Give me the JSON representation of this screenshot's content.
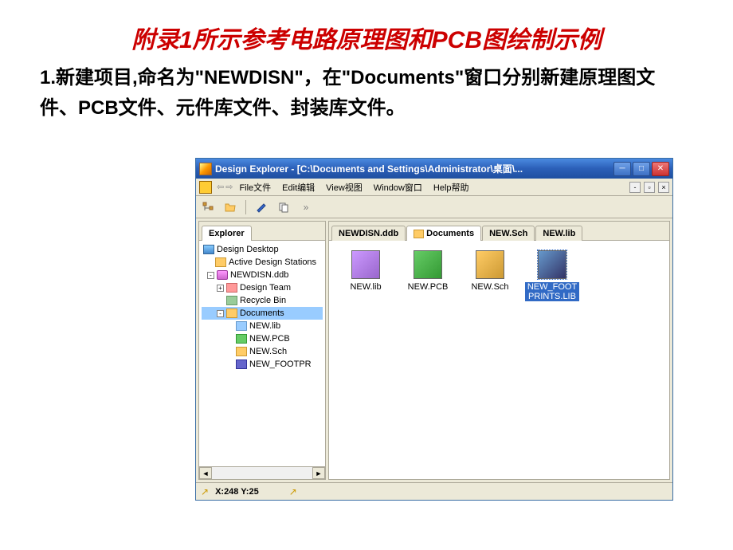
{
  "slide": {
    "title": "附录1所示参考电路原理图和PCB图绘制示例",
    "body": "1.新建项目,命名为\"NEWDISN\"，在\"Documents\"窗口分别新建原理图文件、PCB文件、元件库文件、封装库文件。"
  },
  "window": {
    "title": "Design Explorer - [C:\\Documents and Settings\\Administrator\\桌面\\...",
    "menus": {
      "file": "File文件",
      "edit": "Edit编辑",
      "view": "View视图",
      "window": "Window窗口",
      "help": "Help帮助"
    }
  },
  "explorer": {
    "tab": "Explorer",
    "tree": {
      "root": "Design Desktop",
      "stations": "Active Design Stations",
      "project": "NEWDISN.ddb",
      "team": "Design Team",
      "recycle": "Recycle Bin",
      "documents": "Documents",
      "files": {
        "lib": "NEW.lib",
        "pcb": "NEW.PCB",
        "sch": "NEW.Sch",
        "fp": "NEW_FOOTPR"
      }
    }
  },
  "content": {
    "tabs": {
      "ddb": "NEWDISN.ddb",
      "documents": "Documents",
      "sch": "NEW.Sch",
      "lib": "NEW.lib"
    },
    "files": {
      "lib": "NEW.lib",
      "pcb": "NEW.PCB",
      "sch": "NEW.Sch",
      "fp": "NEW_FOOTPRINTS.LIB"
    }
  },
  "status": {
    "coords": "X:248 Y:25"
  }
}
